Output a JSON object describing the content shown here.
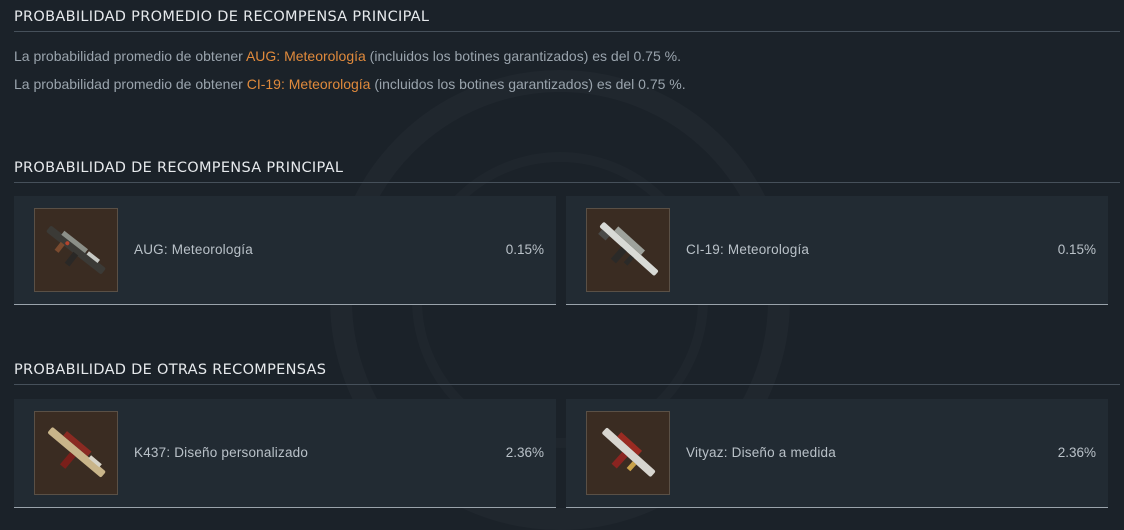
{
  "sections": {
    "average": {
      "title": "PROBABILIDAD PROMEDIO DE RECOMPENSA PRINCIPAL",
      "lines": [
        {
          "prefix": "La probabilidad promedio de obtener ",
          "item": "AUG: Meteorología",
          "suffix": " (incluidos los botines garantizados) es del 0.75 %."
        },
        {
          "prefix": "La probabilidad promedio de obtener ",
          "item": "CI-19: Meteorología",
          "suffix": " (incluidos los botines garantizados) es del 0.75 %."
        }
      ]
    },
    "main": {
      "title": "PROBABILIDAD DE RECOMPENSA PRINCIPAL",
      "items": [
        {
          "name": "AUG: Meteorología",
          "pct": "0.15%",
          "icon": "aug-weapon-icon"
        },
        {
          "name": "CI-19: Meteorología",
          "pct": "0.15%",
          "icon": "ci19-weapon-icon"
        }
      ]
    },
    "other": {
      "title": "PROBABILIDAD DE OTRAS RECOMPENSAS",
      "items": [
        {
          "name": "K437: Diseño personalizado",
          "pct": "2.36%",
          "icon": "k437-weapon-icon"
        },
        {
          "name": "Vityaz: Diseño a medida",
          "pct": "2.36%",
          "icon": "vityaz-weapon-icon"
        }
      ]
    }
  },
  "colors": {
    "highlight": "#e08a3c",
    "background": "#1b2229",
    "card": "#222b33"
  }
}
